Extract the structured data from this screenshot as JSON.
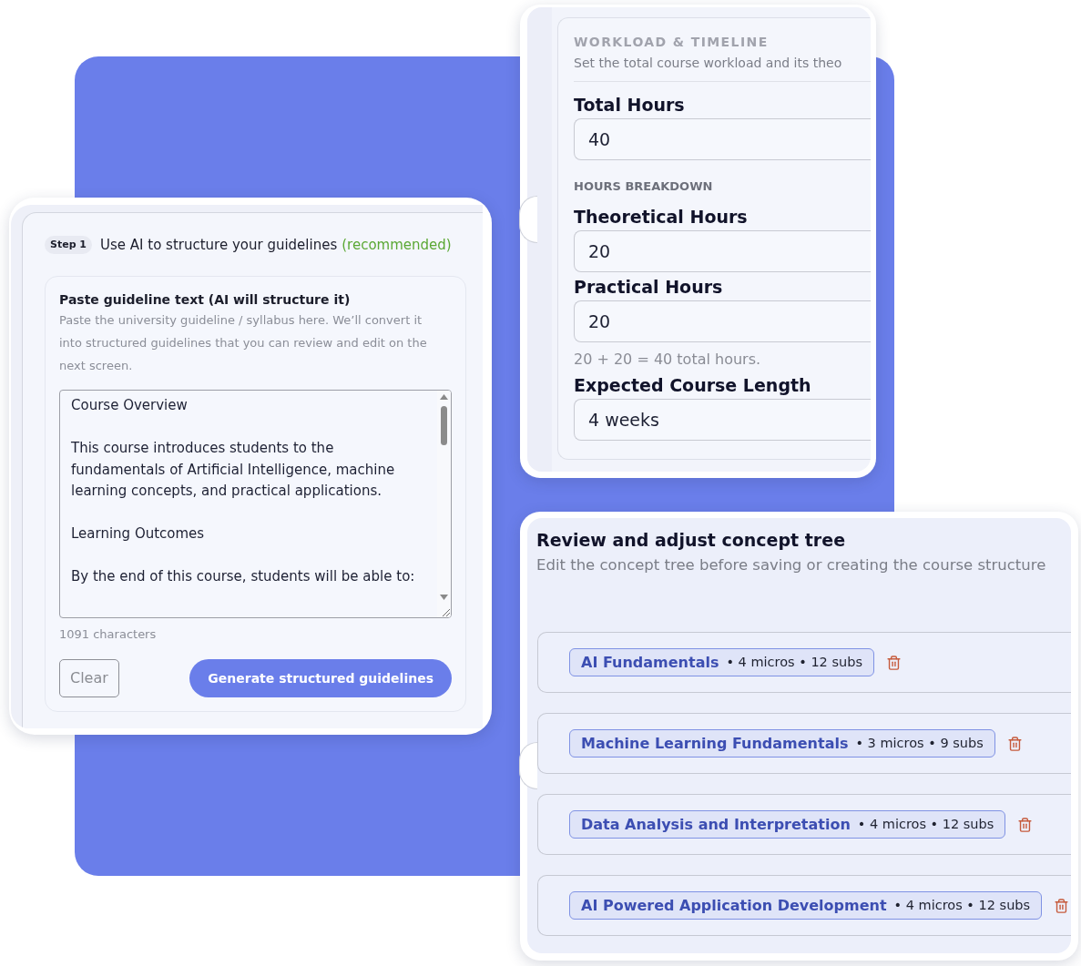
{
  "guidelines_card": {
    "step_badge": "Step 1",
    "title": "Use AI to structure your guidelines",
    "title_note": "(recommended)",
    "section": {
      "title": "Paste guideline text (AI will structure it)",
      "description": "Paste the university guideline / syllabus here. We’ll convert it into structured guidelines that you can review and edit on the next screen.",
      "textarea": {
        "paragraphs": [
          [
            "Course Overview"
          ],
          [
            "This course introduces students to the",
            "fundamentals of Artificial Intelligence, machine",
            "learning concepts, and practical applications."
          ],
          [
            "Learning Outcomes"
          ],
          [
            "By the end of this course, students will be able to:"
          ]
        ]
      },
      "char_count": "1091 characters",
      "buttons": [
        {
          "label": "Clear",
          "kind": "outline"
        },
        {
          "label": "Generate structured guidelines",
          "kind": "primary"
        }
      ]
    }
  },
  "workload_card": {
    "heading": "WORKLOAD & TIMELINE",
    "subtitle": "Set the total course workload and its theo",
    "items": [
      {
        "kind": "field",
        "label": "Total Hours",
        "value": "40"
      },
      {
        "kind": "section",
        "label": "HOURS BREAKDOWN"
      },
      {
        "kind": "field",
        "label": "Theoretical Hours",
        "value": "20"
      },
      {
        "kind": "field",
        "label": "Practical Hours",
        "value": "20"
      },
      {
        "kind": "note",
        "text": "20 + 20 = 40 total hours."
      },
      {
        "kind": "field",
        "label": "Expected Course Length",
        "value": "4 weeks"
      }
    ]
  },
  "concept_tree_card": {
    "title": "Review and adjust concept tree",
    "subtitle": "Edit the concept tree before saving or creating the course structure",
    "nodes": [
      {
        "title": "AI Fundamentals",
        "meta": "• 4 micros • 12 subs"
      },
      {
        "title": "Machine Learning Fundamentals",
        "meta": "• 3 micros • 9 subs"
      },
      {
        "title": "Data Analysis and Interpretation",
        "meta": "• 4 micros • 12 subs"
      },
      {
        "title": "AI Powered Application Development",
        "meta": "• 4 micros • 12 subs"
      }
    ]
  }
}
